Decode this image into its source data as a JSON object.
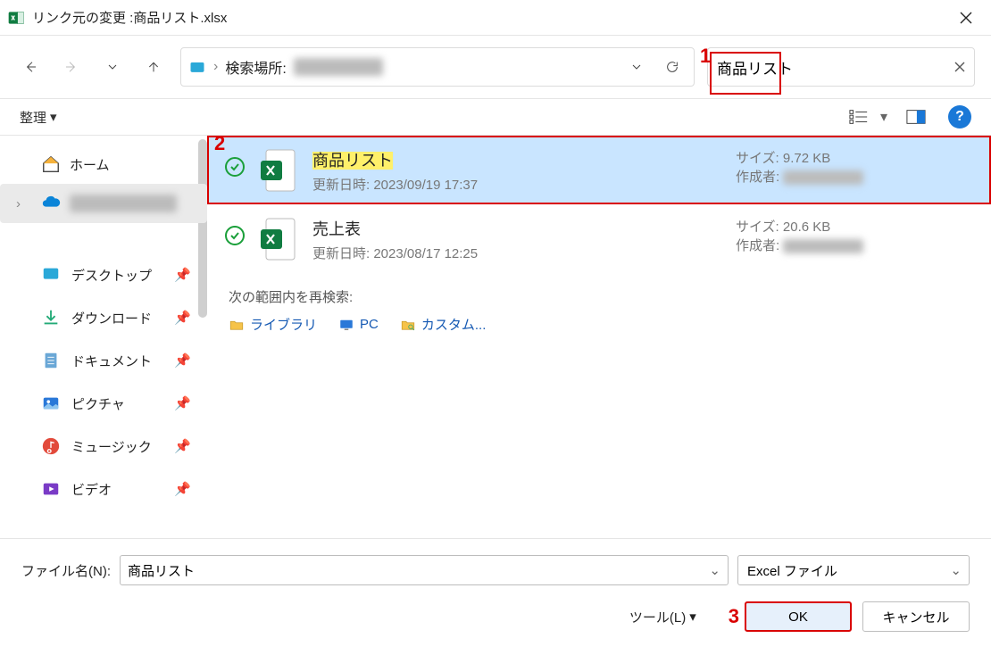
{
  "title": "リンク元の変更 :商品リスト.xlsx",
  "addressbar": {
    "prefix": "検索場所:"
  },
  "search": {
    "value": "商品リスト"
  },
  "toolbar": {
    "organize": "整理"
  },
  "tree": {
    "home": "ホーム",
    "onedrive": ""
  },
  "quick_items": [
    {
      "label": "デスクトップ"
    },
    {
      "label": "ダウンロード"
    },
    {
      "label": "ドキュメント"
    },
    {
      "label": "ピクチャ"
    },
    {
      "label": "ミュージック"
    },
    {
      "label": "ビデオ"
    }
  ],
  "files": [
    {
      "name": "商品リスト",
      "meta_label": "更新日時:",
      "meta_value": "2023/09/19 17:37",
      "size_label": "サイズ:",
      "size_value": "9.72 KB",
      "author_label": "作成者:",
      "selected": true,
      "highlight": true
    },
    {
      "name": "売上表",
      "meta_label": "更新日時:",
      "meta_value": "2023/08/17 12:25",
      "size_label": "サイズ:",
      "size_value": "20.6 KB",
      "author_label": "作成者:",
      "selected": false,
      "highlight": false
    }
  ],
  "re_search": {
    "header": "次の範囲内を再検索:",
    "links": [
      "ライブラリ",
      "PC",
      "カスタム..."
    ]
  },
  "footer": {
    "filename_label": "ファイル名(N):",
    "filename_value": "商品リスト",
    "filetype_value": "Excel ファイル",
    "tools": "ツール(L)",
    "ok": "OK",
    "cancel": "キャンセル"
  },
  "annotations": {
    "n1": "1",
    "n2": "2",
    "n3": "3"
  }
}
